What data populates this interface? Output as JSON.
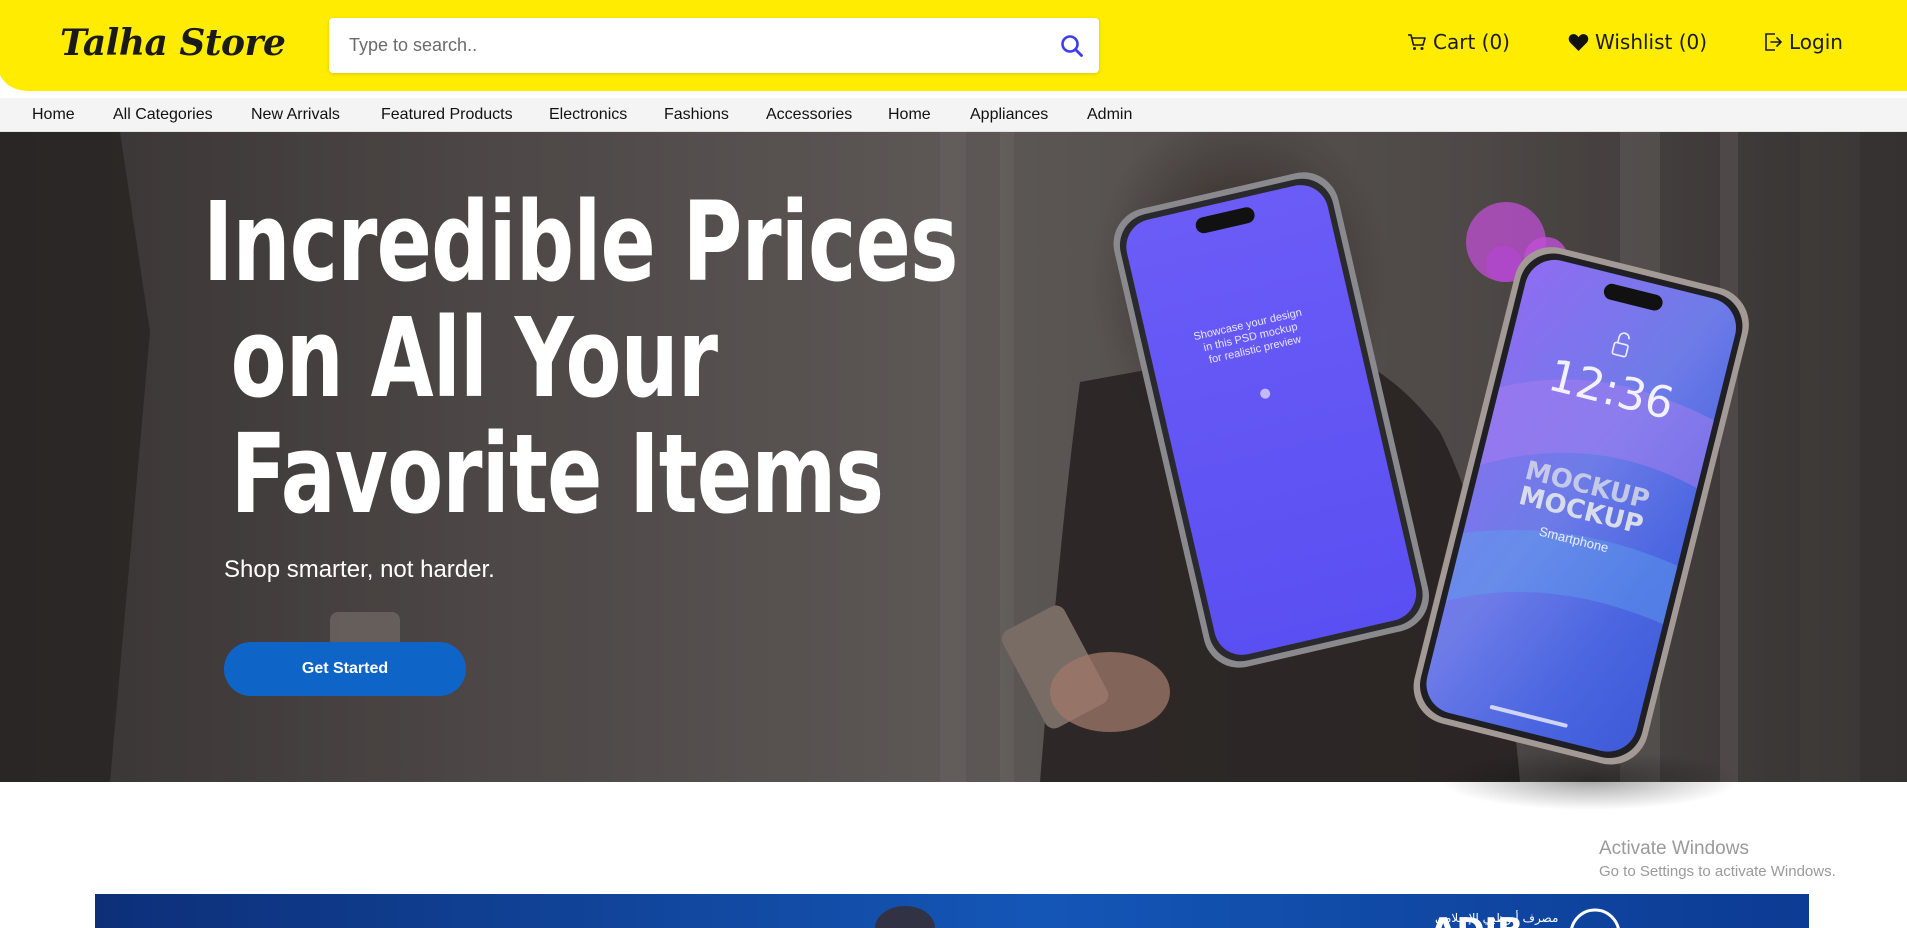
{
  "header": {
    "logo_text": "Talha Store",
    "search_placeholder": "Type to search..",
    "cart_label": "Cart (0)",
    "wishlist_label": "Wishlist (0)",
    "login_label": "Login",
    "brand_color": "#ffec00"
  },
  "nav": {
    "items": [
      {
        "label": "Home"
      },
      {
        "label": "All Categories"
      },
      {
        "label": "New Arrivals"
      },
      {
        "label": "Featured Products"
      },
      {
        "label": "Electronics"
      },
      {
        "label": "Fashions"
      },
      {
        "label": "Accessories"
      },
      {
        "label": "Home"
      },
      {
        "label": "Appliances"
      },
      {
        "label": "Admin"
      }
    ]
  },
  "hero": {
    "title_lines": [
      "Incredible Prices",
      " on All Your",
      " Favorite Items"
    ],
    "subtitle": "Shop smarter, not harder.",
    "cta_label": "Get Started",
    "cta_color": "#0f64c8",
    "phone_back": {
      "screen_text": [
        "Showcase your design",
        "in this PSD mockup",
        "for realistic preview"
      ]
    },
    "phone_front": {
      "time": "12:36",
      "mockup_lines": [
        "MOCKUP",
        "MOCKUP"
      ],
      "label": "Smartphone"
    }
  },
  "watermark": {
    "title": "Activate Windows",
    "subtitle": "Go to Settings to activate Windows."
  },
  "promo_banner": {
    "label_partial": "ADIB",
    "arabic_partial": "مصرف أبوظبي الإسلامي"
  }
}
